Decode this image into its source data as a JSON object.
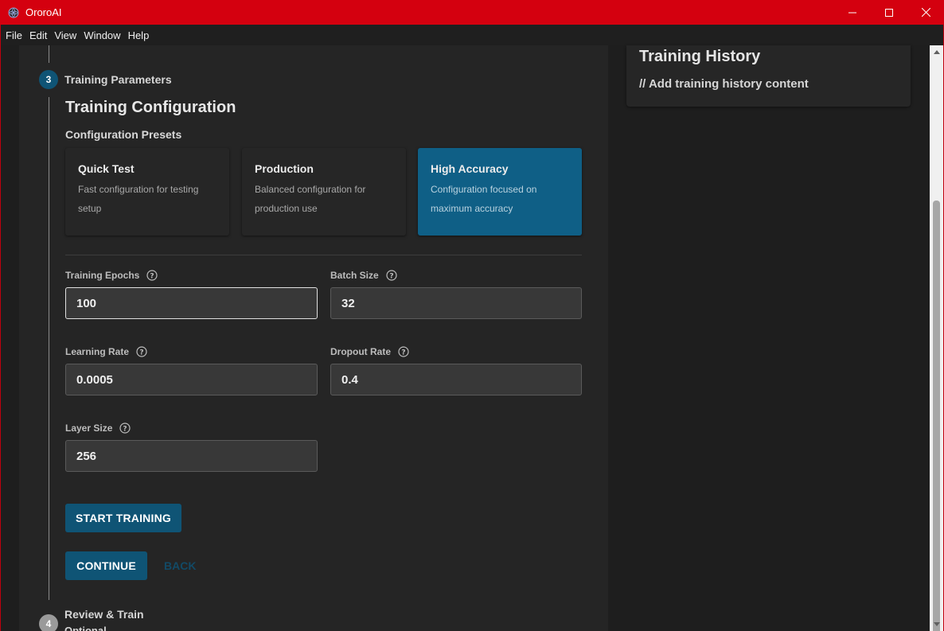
{
  "window": {
    "title": "OroroAI",
    "accent_color": "#d4000f"
  },
  "menu": [
    "File",
    "Edit",
    "View",
    "Window",
    "Help"
  ],
  "stepper": {
    "current": {
      "number": "3",
      "label": "Training Parameters"
    },
    "next": {
      "number": "4",
      "label": "Review & Train",
      "sublabel": "Optional"
    }
  },
  "config": {
    "title": "Training Configuration",
    "presets_title": "Configuration Presets",
    "presets": [
      {
        "name": "Quick Test",
        "description": "Fast configuration for testing setup",
        "selected": false
      },
      {
        "name": "Production",
        "description": "Balanced configuration for production use",
        "selected": false
      },
      {
        "name": "High Accuracy",
        "description": "Configuration focused on maximum accuracy",
        "selected": true
      }
    ],
    "fields": {
      "epochs": {
        "label": "Training Epochs",
        "value": "100"
      },
      "batch_size": {
        "label": "Batch Size",
        "value": "32"
      },
      "learning_rate": {
        "label": "Learning Rate",
        "value": "0.0005"
      },
      "dropout_rate": {
        "label": "Dropout Rate",
        "value": "0.4"
      },
      "layer_size": {
        "label": "Layer Size",
        "value": "256"
      }
    },
    "start_button": "START TRAINING",
    "continue_button": "CONTINUE",
    "back_button": "BACK"
  },
  "history": {
    "title": "Training History",
    "content": "// Add training history content"
  },
  "colors": {
    "primary": "#0f5475",
    "selected_card": "#0f5f86",
    "step_active": "#0f5475",
    "step_inactive": "#9a9a9a"
  }
}
